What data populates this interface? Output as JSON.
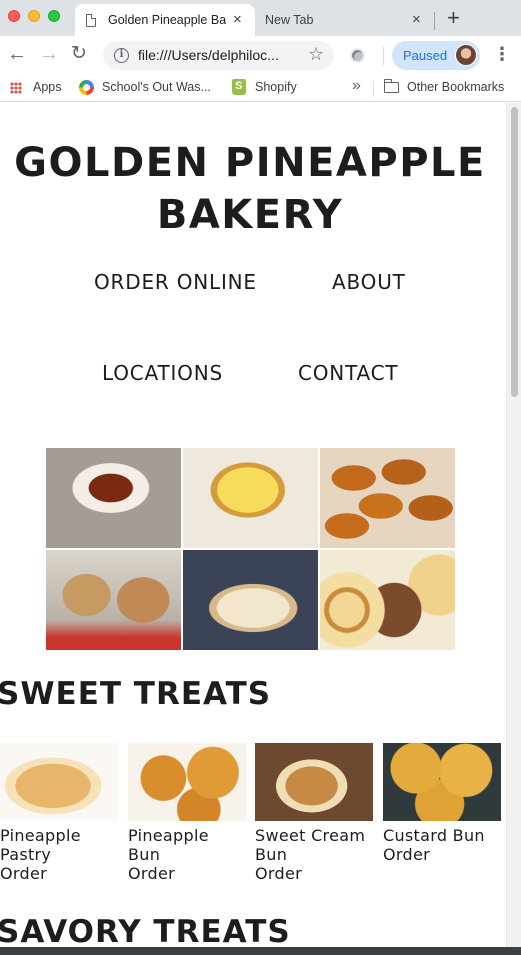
{
  "browser": {
    "tabs": [
      {
        "title": "Golden Pineapple Ba",
        "active": true
      },
      {
        "title": "New Tab",
        "active": false
      }
    ],
    "new_tab_symbol": "+",
    "close_symbol": "×",
    "url": "file:///Users/delphiloc...",
    "profile_status": "Paused",
    "bookmarks": {
      "apps": "Apps",
      "items": [
        "School's Out Was...",
        "Shopify"
      ],
      "overflow": "»",
      "other": "Other Bookmarks"
    }
  },
  "site": {
    "title_line1": "GOLDEN PINEAPPLE",
    "title_line2": "BAKERY",
    "nav": {
      "order_online": "ORDER ONLINE",
      "about": "ABOUT",
      "locations": "LOCATIONS",
      "contact": "CONTACT"
    },
    "sections": {
      "sweet": "SWEET TREATS",
      "savory": "SAVORY TREATS"
    },
    "sweet_products": [
      {
        "name": "Pineapple Pastry",
        "order": "Order"
      },
      {
        "name": "Pineapple Bun",
        "order": "Order"
      },
      {
        "name": "Sweet Cream Bun",
        "order": "Order"
      },
      {
        "name": "Custard Bun",
        "order": "Order"
      }
    ]
  },
  "colors": {
    "tab_strip": "#dee1e6",
    "paused_chip": "#d2e3fc",
    "paused_text": "#1a73e8",
    "site_text": "#1d1d1d"
  },
  "icons": [
    "page-icon",
    "back-arrow-icon",
    "forward-arrow-icon",
    "reload-icon",
    "info-icon",
    "star-icon",
    "extension-icon",
    "avatar",
    "more-vert-icon",
    "apps-grid-icon",
    "folder-icon"
  ]
}
